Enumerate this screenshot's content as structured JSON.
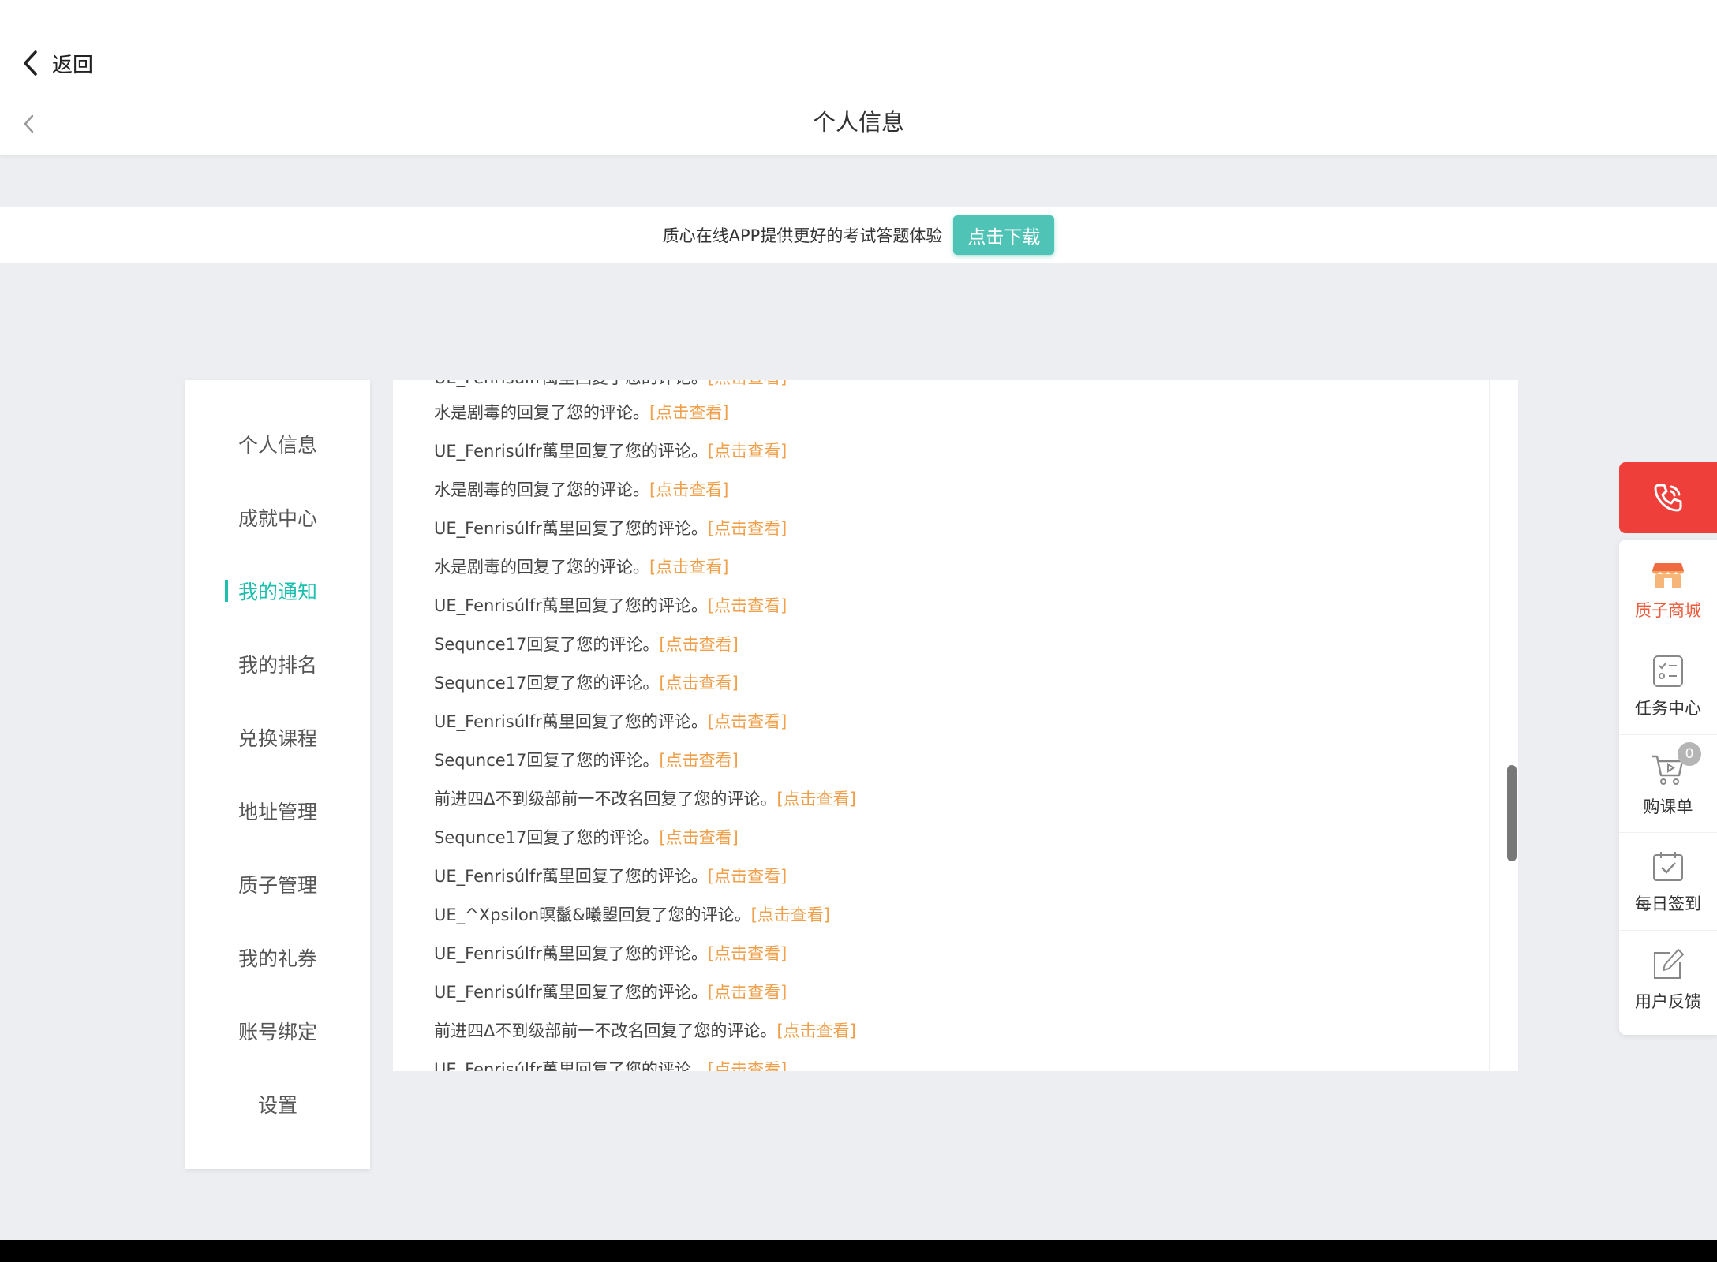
{
  "header": {
    "back_label": "返回",
    "title": "个人信息"
  },
  "banner": {
    "text": "质心在线APP提供更好的考试答题体验",
    "button": "点击下载"
  },
  "colors": {
    "accent": "#1cbfae",
    "link": "#f0a04b",
    "call": "#ef3f3a",
    "shop": "#ee5a3a",
    "download_btn": "#4fc3b6"
  },
  "menu": {
    "active_index": 2,
    "items": [
      {
        "label": "个人信息"
      },
      {
        "label": "成就中心"
      },
      {
        "label": "我的通知"
      },
      {
        "label": "我的排名"
      },
      {
        "label": "兑换课程"
      },
      {
        "label": "地址管理"
      },
      {
        "label": "质子管理"
      },
      {
        "label": "我的礼券"
      },
      {
        "label": "账号绑定"
      },
      {
        "label": "设置"
      }
    ]
  },
  "notices": {
    "link_text": "[点击查看]",
    "items": [
      {
        "text": "UE_Fenrisúlfr萬里回复了您的评论。"
      },
      {
        "text": "水是剧毒的回复了您的评论。"
      },
      {
        "text": "UE_Fenrisúlfr萬里回复了您的评论。"
      },
      {
        "text": "水是剧毒的回复了您的评论。"
      },
      {
        "text": "UE_Fenrisúlfr萬里回复了您的评论。"
      },
      {
        "text": "水是剧毒的回复了您的评论。"
      },
      {
        "text": "UE_Fenrisúlfr萬里回复了您的评论。"
      },
      {
        "text": "Sequnce17回复了您的评论。"
      },
      {
        "text": "Sequnce17回复了您的评论。"
      },
      {
        "text": "UE_Fenrisúlfr萬里回复了您的评论。"
      },
      {
        "text": "Sequnce17回复了您的评论。"
      },
      {
        "text": "前进四Δ不到级部前一不改名回复了您的评论。"
      },
      {
        "text": "Sequnce17回复了您的评论。"
      },
      {
        "text": "UE_Fenrisúlfr萬里回复了您的评论。"
      },
      {
        "text": "UE_^Xpsilon暝鬣&曦曌回复了您的评论。"
      },
      {
        "text": "UE_Fenrisúlfr萬里回复了您的评论。"
      },
      {
        "text": "UE_Fenrisúlfr萬里回复了您的评论。"
      },
      {
        "text": "前进四Δ不到级部前一不改名回复了您的评论。"
      },
      {
        "text": "UE_Fenrisúlfr萬里回复了您的评论。"
      }
    ]
  },
  "float_bar": {
    "call_icon": "phone-icon",
    "items": [
      {
        "label": "质子商城",
        "icon": "shop-icon"
      },
      {
        "label": "任务中心",
        "icon": "task-list-icon"
      },
      {
        "label": "购课单",
        "icon": "cart-icon",
        "badge": "0"
      },
      {
        "label": "每日签到",
        "icon": "calendar-check-icon"
      },
      {
        "label": "用户反馈",
        "icon": "edit-icon"
      }
    ]
  }
}
